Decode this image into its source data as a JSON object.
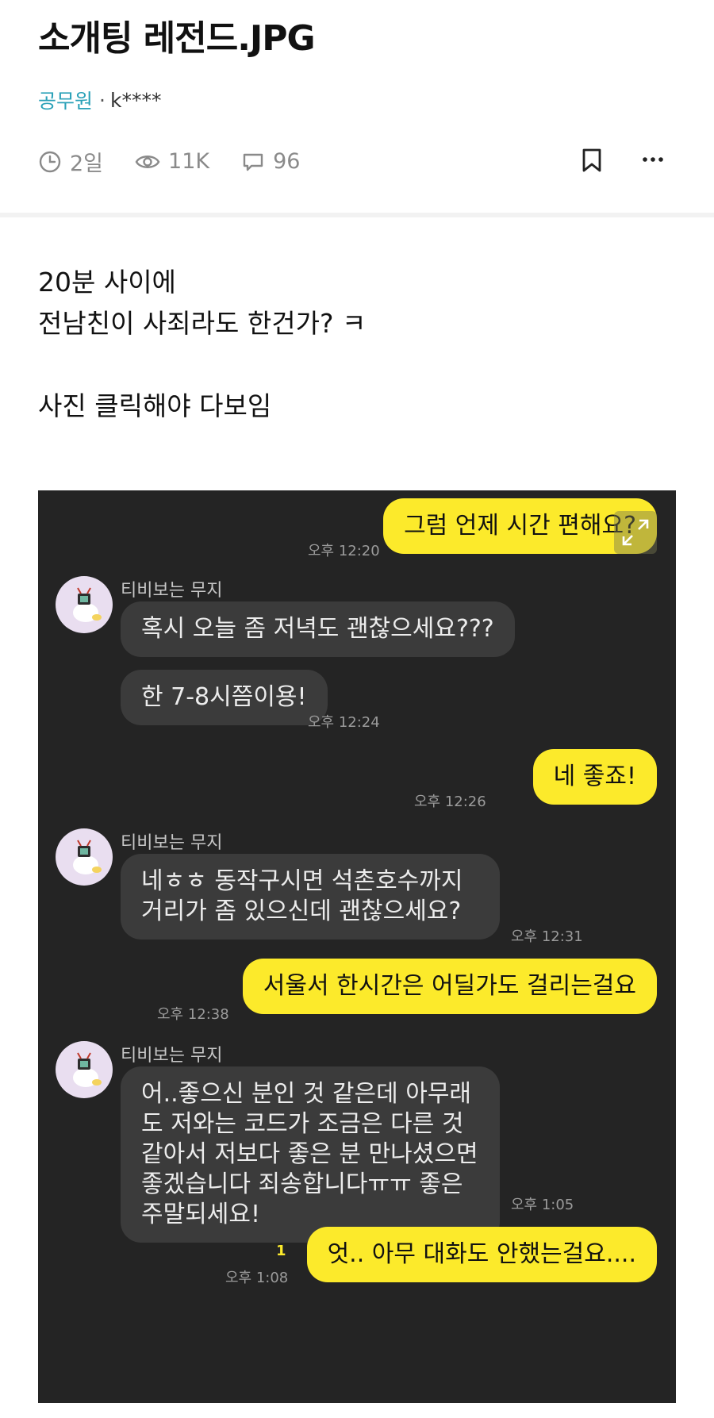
{
  "post": {
    "title": "소개팅 레전드.JPG",
    "category": "공무원",
    "separator": "·",
    "author": "k****",
    "stats": {
      "age": "2일",
      "views": "11K",
      "comments": "96"
    },
    "body_lines": [
      "20분 사이에",
      "전남친이 사죄라도 한건가? ㅋ",
      "",
      "사진 클릭해야 다보임"
    ]
  },
  "chat": {
    "sender_name": "티비보는 무지",
    "messages": [
      {
        "from": "me",
        "text": "그럼 언제 시간 편해요?",
        "time": "오후 12:20"
      },
      {
        "from": "them",
        "text": "혹시 오늘 좀 저녁도 괜찮으세요???"
      },
      {
        "from": "them",
        "text": "한 7-8시쯤이용!",
        "time": "오후 12:24"
      },
      {
        "from": "me",
        "text": "네 좋죠!",
        "time": "오후 12:26"
      },
      {
        "from": "them",
        "text": "네ㅎㅎ 동작구시면 석촌호수까지 거리가 좀 있으신데 괜찮으세요?",
        "time": "오후 12:31"
      },
      {
        "from": "me",
        "text": "서울서 한시간은 어딜가도 걸리는걸요",
        "time": "오후 12:38"
      },
      {
        "from": "them",
        "text": "어..좋으신 분인 것 같은데 아무래도 저와는 코드가 조금은 다른 것 같아서 저보다 좋은 분 만나셨으면 좋겠습니다 죄송합니다ㅠㅠ 좋은 주말되세요!",
        "time": "오후 1:05"
      },
      {
        "from": "me",
        "text": "엇.. 아무 대화도 안했는걸요....",
        "time": "오후 1:08",
        "unread": "1"
      }
    ]
  },
  "colors": {
    "accent": "#2aa1b8",
    "chat_bg": "#242424",
    "my_bubble": "#fcea2b",
    "their_bubble": "#3b3b3b"
  }
}
